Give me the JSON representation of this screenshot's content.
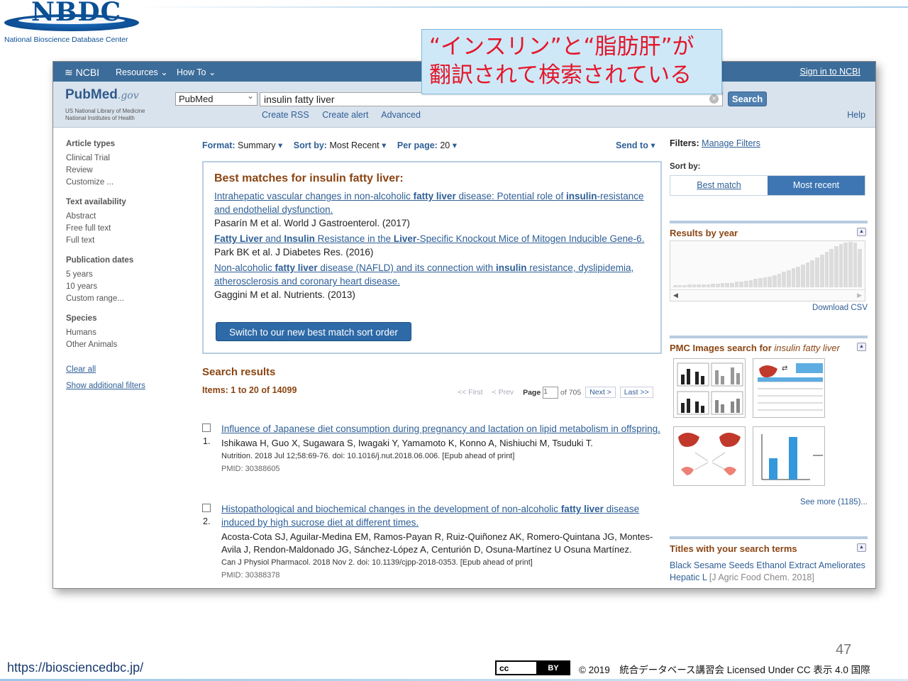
{
  "slide": {
    "logo_text": "NBDC",
    "logo_sub": "National Bioscience Database Center",
    "callout_lines": [
      "“インスリン”と“脂肪肝”が",
      "翻訳されて検索されている"
    ],
    "url": "https://biosciencedbc.jp/",
    "page_number": "47",
    "cc_label": "cc",
    "by_label": "BY",
    "license": "© 2019　統合データベース講習会 Licensed Under CC 表示 4.0 国際"
  },
  "ncbi": {
    "brand": "NCBI",
    "resources": "Resources",
    "howto": "How To",
    "signin": "Sign in to NCBI"
  },
  "header": {
    "logo_pub": "Pub",
    "logo_med": "Med",
    "logo_gov": ".gov",
    "logo_sub1": "US National Library of Medicine",
    "logo_sub2": "National Institutes of Health",
    "db_value": "PubMed",
    "query": "insulin fatty liver",
    "search_label": "Search",
    "links": [
      "Create RSS",
      "Create alert",
      "Advanced"
    ],
    "help": "Help"
  },
  "left_filters": {
    "groups": [
      {
        "heading": "Article types",
        "items": [
          "Clinical Trial",
          "Review",
          "Customize ..."
        ]
      },
      {
        "heading": "Text availability",
        "items": [
          "Abstract",
          "Free full text",
          "Full text"
        ]
      },
      {
        "heading": "Publication dates",
        "items": [
          "5 years",
          "10 years",
          "Custom range..."
        ]
      },
      {
        "heading": "Species",
        "items": [
          "Humans",
          "Other Animals"
        ]
      }
    ],
    "clear_all": "Clear all",
    "show_additional": "Show additional filters"
  },
  "toolbar": {
    "format_label": "Format:",
    "format_value": "Summary",
    "sort_label": "Sort by:",
    "sort_value": "Most Recent",
    "perpage_label": "Per page:",
    "perpage_value": "20",
    "send_to": "Send to"
  },
  "best_matches": {
    "title": "Best matches for insulin fatty liver:",
    "items": [
      {
        "title_html": "Intrahepatic vascular changes in non-alcoholic <b>fatty liver</b> disease: Potential role of <b>insulin</b>-resistance and endothelial dysfunction.",
        "cite": "Pasarín M et al. World J Gastroenterol. (2017)"
      },
      {
        "title_html": "<b>Fatty Liver</b> and <b>Insulin</b> Resistance in the <b>Liver</b>-Specific Knockout Mice of Mitogen Inducible Gene-6.",
        "cite": "Park BK et al. J Diabetes Res. (2016)"
      },
      {
        "title_html": "Non-alcoholic <b>fatty liver</b> disease (NAFLD) and its connection with <b>insulin</b> resistance, dyslipidemia, atherosclerosis and coronary heart disease.",
        "cite": "Gaggini M et al. Nutrients. (2013)"
      }
    ],
    "switch_label": "Switch to our new best match sort order"
  },
  "results": {
    "heading": "Search results",
    "items_text": "Items: 1 to 20 of 14099",
    "pager": {
      "first": "<< First",
      "prev": "< Prev",
      "page_label": "Page",
      "page_value": "1",
      "of": "of 705",
      "next": "Next >",
      "last": "Last >>"
    },
    "list": [
      {
        "num": "1.",
        "title_html": "Influence of Japanese diet consumption during pregnancy and lactation on lipid metabolism in offspring.",
        "authors": "Ishikawa H, Guo X, Sugawara S, Iwagaki Y, Yamamoto K, Konno A, Nishiuchi M, Tsuduki T.",
        "journal": "Nutrition. 2018 Jul 12;58:69-76. doi: 10.1016/j.nut.2018.06.006. [Epub ahead of print]",
        "pmid": "PMID: 30388605"
      },
      {
        "num": "2.",
        "title_html": "Histopathological and biochemical changes in the development of non-alcoholic <b>fatty liver</b> disease induced by high sucrose diet at different times.",
        "authors": "Acosta-Cota SJ, Aguilar-Medina EM, Ramos-Payan R, Ruiz-Quiñonez AK, Romero-Quintana JG, Montes-Avila J, Rendon-Maldonado JG, Sánchez-López A, Centurión D, Osuna-Martínez U Osuna Martínez.",
        "journal": "Can J Physiol Pharmacol. 2018 Nov 2. doi: 10.1139/cjpp-2018-0353. [Epub ahead of print]",
        "pmid": "PMID: 30388378"
      }
    ]
  },
  "right": {
    "filters_label": "Filters:",
    "manage_filters": "Manage Filters",
    "sort_by": "Sort by:",
    "best_match": "Best match",
    "most_recent": "Most recent",
    "results_by_year": "Results by year",
    "year_levels": [
      0.05,
      0.05,
      0.05,
      0.06,
      0.06,
      0.06,
      0.07,
      0.07,
      0.08,
      0.08,
      0.09,
      0.1,
      0.1,
      0.12,
      0.13,
      0.14,
      0.16,
      0.18,
      0.2,
      0.22,
      0.24,
      0.27,
      0.3,
      0.34,
      0.38,
      0.42,
      0.46,
      0.5,
      0.55,
      0.6,
      0.66,
      0.72,
      0.78,
      0.84,
      0.9,
      0.95,
      0.98,
      1.0,
      0.98,
      0.85
    ],
    "download_csv": "Download CSV",
    "pmc_label": "PMC Images search for ",
    "pmc_query": "insulin fatty liver",
    "see_more": "See more (1185)...",
    "titles_heading": "Titles with your search terms",
    "titles_link": "Black Sesame Seeds Ethanol Extract Ameliorates Hepatic L",
    "titles_source": "[J Agric Food Chem. 2018]"
  }
}
